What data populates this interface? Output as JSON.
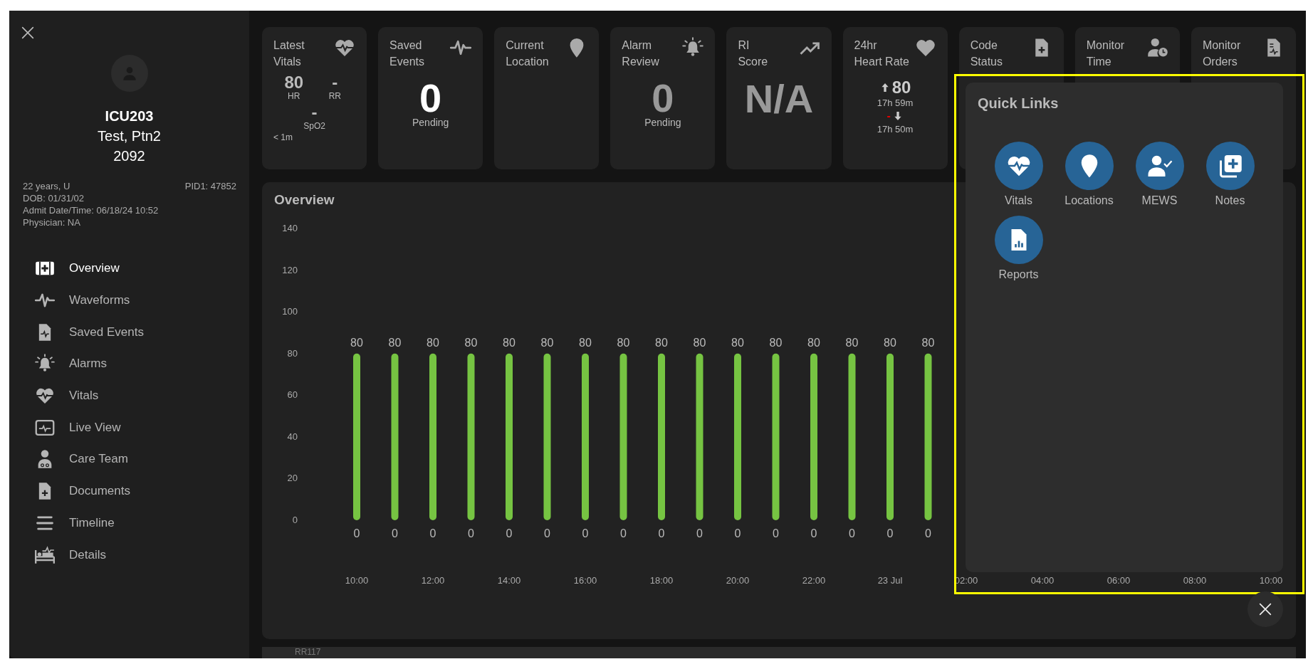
{
  "patient": {
    "bed": "ICU203",
    "name": "Test, Ptn2",
    "number": "2092",
    "age": "22 years, U",
    "pid": "PID1: 47852",
    "dob": "DOB: 01/31/02",
    "admit": "Admit Date/Time: 06/18/24 10:52",
    "physician": "Physician: NA"
  },
  "nav": [
    {
      "label": "Overview",
      "selected": true
    },
    {
      "label": "Waveforms",
      "selected": false
    },
    {
      "label": "Saved Events",
      "selected": false
    },
    {
      "label": "Alarms",
      "selected": false
    },
    {
      "label": "Vitals",
      "selected": false
    },
    {
      "label": "Live View",
      "selected": false
    },
    {
      "label": "Care Team",
      "selected": false
    },
    {
      "label": "Documents",
      "selected": false
    },
    {
      "label": "Timeline",
      "selected": false
    },
    {
      "label": "Details",
      "selected": false
    }
  ],
  "cards": [
    {
      "kind": "vitals",
      "title": [
        "Latest",
        "Vitals"
      ],
      "readings": [
        {
          "value": "80",
          "label": "HR"
        },
        {
          "value": "-",
          "label": "RR"
        },
        {
          "value": "-",
          "label": "SpO2"
        }
      ],
      "age": "< 1m"
    },
    {
      "kind": "count",
      "title": [
        "Saved",
        "Events"
      ],
      "count": "0",
      "caption": "Pending",
      "highlighted": true
    },
    {
      "kind": "plain",
      "title": [
        "Current",
        "Location"
      ]
    },
    {
      "kind": "count",
      "title": [
        "Alarm",
        "Review"
      ],
      "count": "0",
      "caption": "Pending",
      "highlighted": false
    },
    {
      "kind": "score",
      "title": [
        "RI",
        "Score"
      ],
      "value": "N/A"
    },
    {
      "kind": "trend",
      "title": [
        "24hr",
        "Heart Rate"
      ],
      "high": {
        "value": "80",
        "time": "17h 59m"
      },
      "low": {
        "value": "-",
        "time": "17h 50m"
      }
    },
    {
      "kind": "plain",
      "title": [
        "Code",
        "Status"
      ]
    },
    {
      "kind": "plain",
      "title": [
        "Monitor",
        "Time"
      ]
    },
    {
      "kind": "plain",
      "title": [
        "Monitor",
        "Orders"
      ]
    }
  ],
  "overview": {
    "chart_data": {
      "type": "bar",
      "title": "Overview",
      "categories": [
        "10:00",
        null,
        "12:00",
        null,
        "14:00",
        null,
        "16:00",
        null,
        "18:00",
        null,
        "20:00",
        null,
        "22:00",
        null,
        "23 Jul",
        null,
        "02:00",
        null,
        "04:00",
        null,
        "06:00",
        null,
        "08:00",
        null,
        "10:00"
      ],
      "ylim": [
        0,
        140
      ],
      "yticks": [
        0,
        20,
        40,
        60,
        80,
        100,
        120,
        140
      ],
      "series": [
        {
          "color": "#76c442",
          "values": [
            80,
            80,
            80,
            80,
            80,
            80,
            80,
            80,
            80,
            80,
            80,
            80,
            80,
            80,
            80,
            80,
            null,
            null,
            null,
            null,
            null,
            null,
            null,
            null,
            null
          ]
        },
        {
          "values": [
            0,
            0,
            0,
            0,
            0,
            0,
            0,
            0,
            0,
            0,
            0,
            0,
            0,
            0,
            0,
            0,
            null,
            null,
            null,
            null,
            null,
            null,
            null,
            null,
            null
          ]
        }
      ],
      "data_labels": true
    }
  },
  "quick_links": {
    "title": "Quick Links",
    "items": [
      {
        "label": "Vitals"
      },
      {
        "label": "Locations"
      },
      {
        "label": "MEWS"
      },
      {
        "label": "Notes"
      },
      {
        "label": "Reports"
      }
    ]
  },
  "footer_text": "RR117"
}
